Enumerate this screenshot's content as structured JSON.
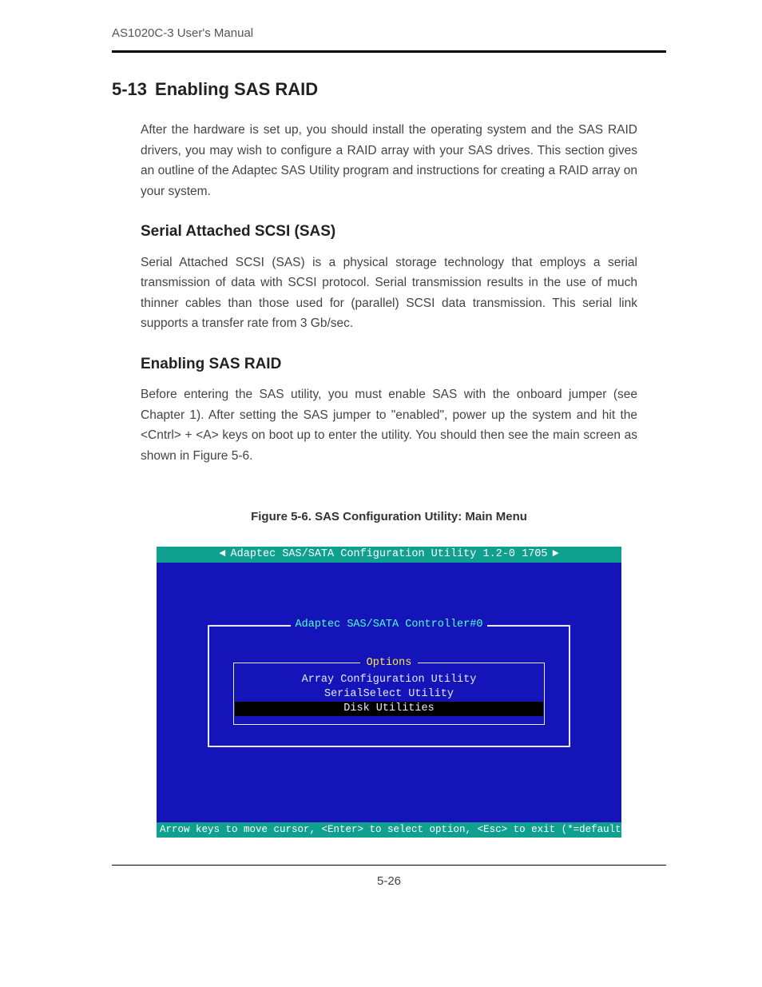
{
  "running_head": "AS1020C-3 User's Manual",
  "section": {
    "number": "5-13",
    "title": "Enabling SAS RAID"
  },
  "para_intro": "After the hardware is set up, you should install the operating system and the SAS RAID drivers, you may wish to configure a RAID array with your SAS drives.  This section gives an outline of the Adaptec SAS Utility program and instructions for creating a RAID array on your system.",
  "subs": [
    {
      "heading": "Serial Attached SCSI (SAS)",
      "para": "Serial Attached SCSI (SAS) is a physical storage technology that employs a serial transmission of data with SCSI protocol.  Serial transmission results in the use of much thinner cables than those used for (parallel) SCSI data transmission.  This serial link supports a transfer rate from 3 Gb/sec."
    },
    {
      "heading": "Enabling SAS RAID",
      "para": "Before entering the SAS utility, you must enable SAS with the onboard jumper (see Chapter 1).  After setting the SAS jumper to \"enabled\", power up the system and hit the <Cntrl> + <A> keys on boot up to enter the utility.  You should then see the main screen as shown in Figure 5-6."
    }
  ],
  "figure_caption": "Figure 5-6. SAS Configuration Utility: Main Menu",
  "bios": {
    "titlebar": "Adaptec SAS/SATA Configuration Utility 1.2-0 1705",
    "panel_title": "Adaptec SAS/SATA Controller#0",
    "options_label": "Options",
    "options": [
      "Array Configuration Utility",
      "SerialSelect Utility",
      "Disk Utilities"
    ],
    "selected_index": 2,
    "statusbar": "Arrow keys to move cursor, <Enter> to select option, <Esc> to exit (*=default)"
  },
  "page_number": "5-26"
}
